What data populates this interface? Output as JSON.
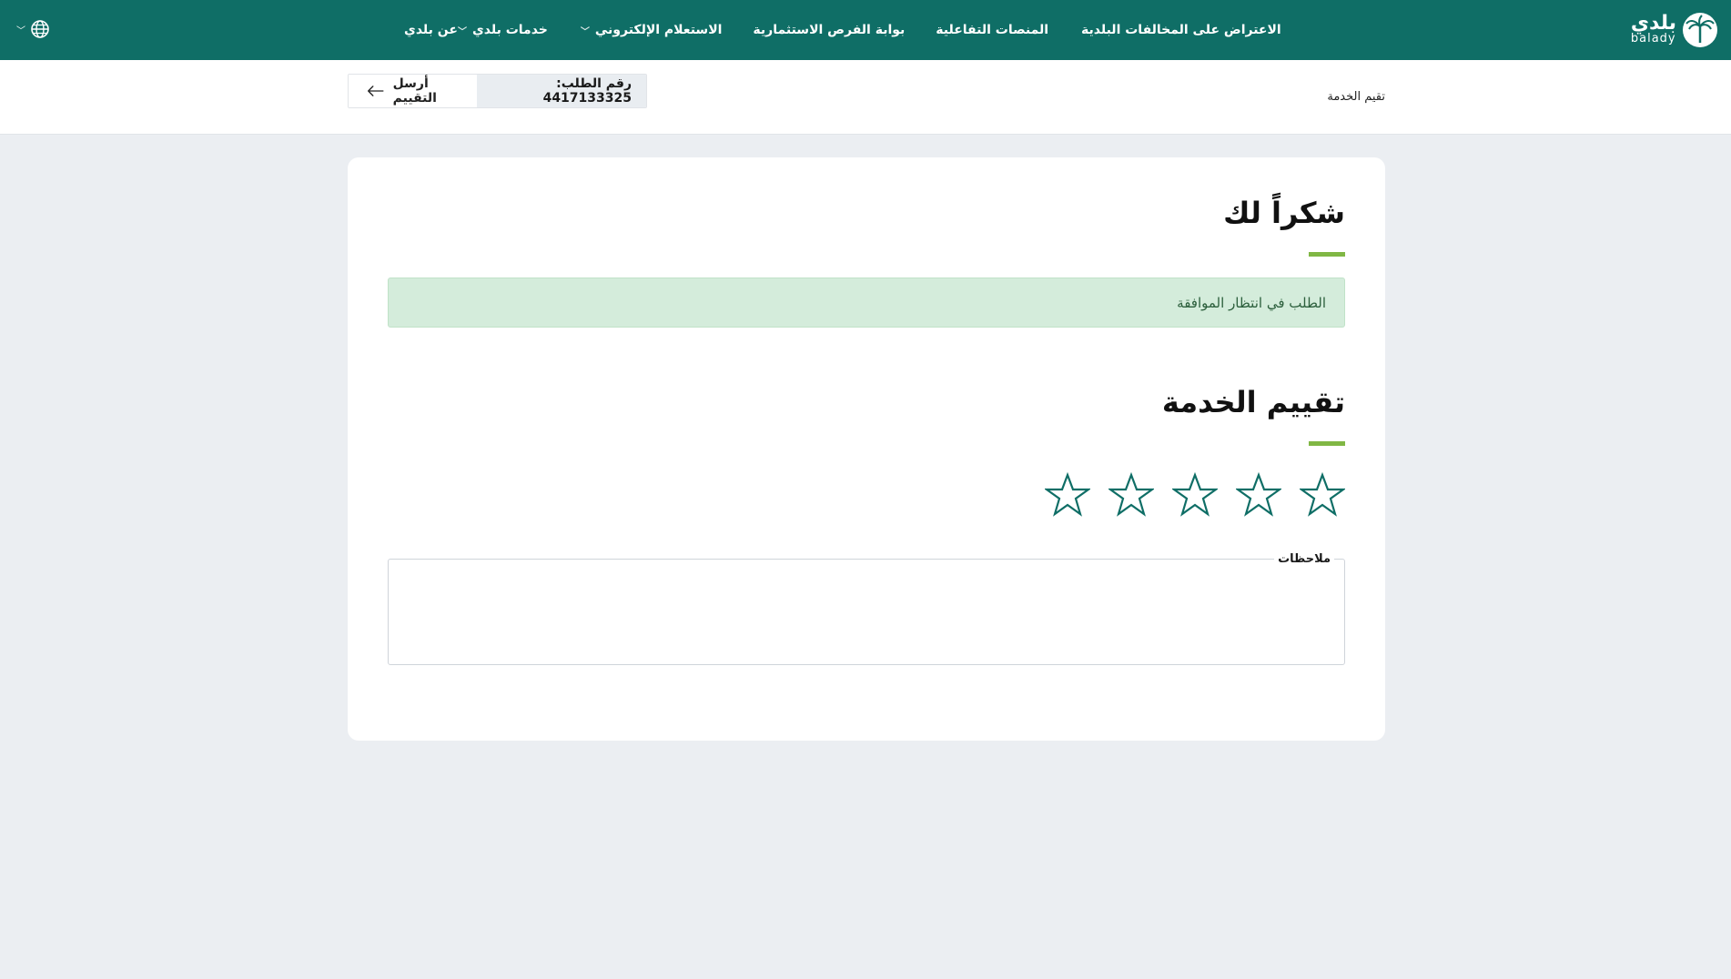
{
  "brand": {
    "name_ar": "بلدي",
    "name_en": "balady"
  },
  "nav": {
    "items": [
      {
        "label": "عن بلدي",
        "has_dropdown": false
      },
      {
        "label": "خدمات بلدي",
        "has_dropdown": true
      },
      {
        "label": "الاستعلام الإلكتروني",
        "has_dropdown": true
      },
      {
        "label": "بوابة الفرص الاستثمارية",
        "has_dropdown": false
      },
      {
        "label": "المنصات التفاعلية",
        "has_dropdown": false
      },
      {
        "label": "الاعتراض على المخالفات البلدية",
        "has_dropdown": false
      }
    ],
    "language_icon": "globe-icon"
  },
  "subheader": {
    "breadcrumb": "تقيم الخدمة",
    "send_rating_label": "أرسل التقييم",
    "request_number": "رقم الطلب: 4417133325"
  },
  "card": {
    "thanks_title": "شكراً لك",
    "status_message": "الطلب في انتظار الموافقة",
    "rating_title": "تقييم الخدمة",
    "rating": {
      "max": 5,
      "value": 0
    },
    "notes_label": "ملاحظات",
    "notes_value": ""
  },
  "colors": {
    "primary": "#0f6e66",
    "accent": "#80b744",
    "alert_bg": "#d4ecdb",
    "page_bg": "#ebeef2"
  }
}
